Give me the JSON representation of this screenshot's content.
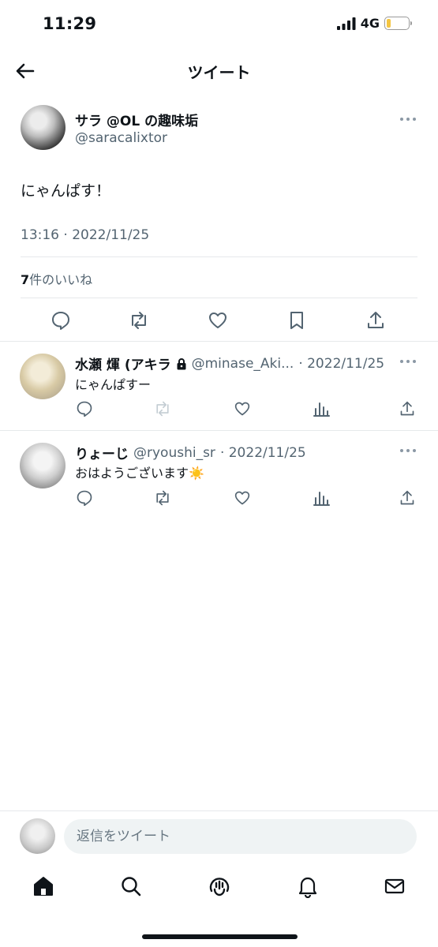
{
  "status_bar": {
    "time": "11:29",
    "network": "4G"
  },
  "nav": {
    "title": "ツイート"
  },
  "tweet": {
    "author_name": "サラ @OL の趣味垢",
    "author_handle": "@saracalixtor",
    "text": "にゃんぱす！",
    "timestamp": "13:16 · 2022/11/25",
    "likes_count": "7",
    "likes_label": "件のいいね"
  },
  "replies": [
    {
      "name": "水瀬 煇 (アキラ",
      "handle": "@minase_Aki...",
      "date": "· 2022/11/25",
      "text": "にゃんぱすー",
      "locked": true
    },
    {
      "name": "りょーじ",
      "handle": "@ryoushi_sr",
      "date": "· 2022/11/25",
      "text": "おはようございます☀️",
      "locked": false
    }
  ],
  "composer": {
    "placeholder": "返信をツイート"
  },
  "colors": {
    "text": "#0f1419",
    "secondary": "#536471",
    "divider": "#e6e9eb",
    "input_bg": "#eff3f4"
  }
}
